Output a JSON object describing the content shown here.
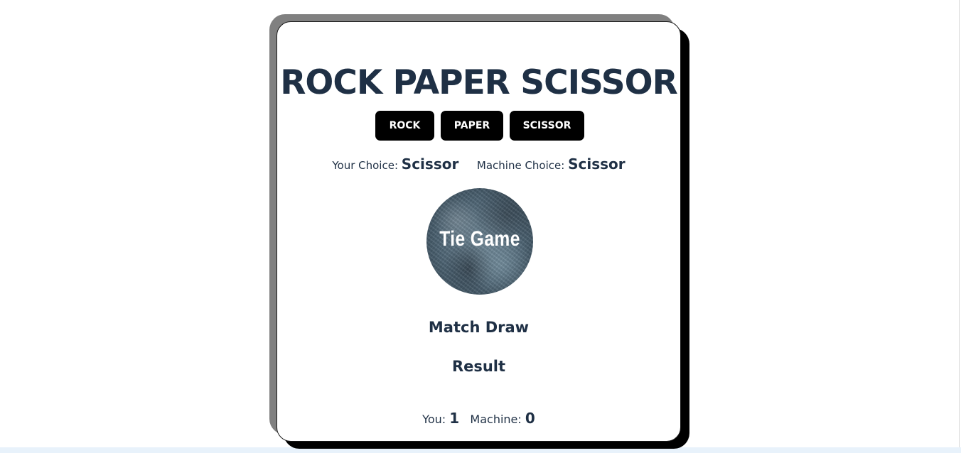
{
  "game": {
    "title": "ROCK PAPER SCISSOR"
  },
  "buttons": {
    "rock": "ROCK",
    "paper": "PAPER",
    "scissor": "SCISSOR"
  },
  "choices": {
    "your_label": "Your Choice:",
    "your_value": "Scissor",
    "machine_label": "Machine Choice:",
    "machine_value": "Scissor"
  },
  "result_image": {
    "text": "Tie Game"
  },
  "status": {
    "match": "Match Draw",
    "result_heading": "Result"
  },
  "score": {
    "you_label": "You:",
    "you_value": "1",
    "machine_label": "Machine:",
    "machine_value": "0"
  },
  "colors": {
    "text": "#1f3045",
    "button_bg": "#000000",
    "button_text": "#ffffff",
    "shadow_gray": "#808080",
    "shadow_black": "#000000"
  }
}
